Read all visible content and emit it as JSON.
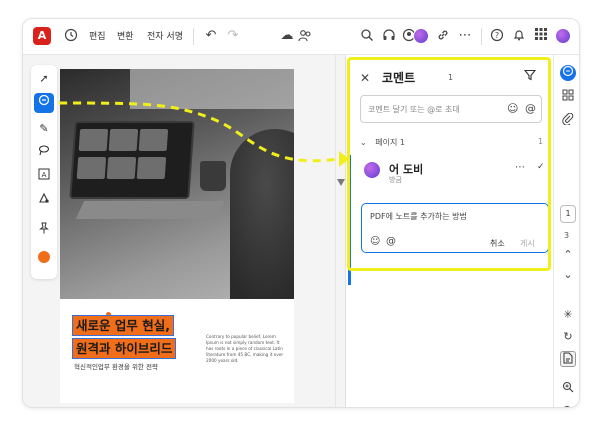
{
  "toolbar": {
    "logo_glyph": "A",
    "menu": [
      "편집",
      "변환",
      "전자 서명"
    ],
    "icons_left": [
      "home-icon",
      "undo-icon",
      "redo-icon",
      "cloud-icon",
      "share-people-icon"
    ],
    "icons_right": [
      "search-icon",
      "headset-icon",
      "collab-icon",
      "link-icon",
      "more-icon",
      "help-icon",
      "bell-icon",
      "apps-icon"
    ]
  },
  "left_tools": [
    "select-icon",
    "comment-icon",
    "pen-icon",
    "lasso-icon",
    "text-box-icon",
    "stamp-icon",
    "pin-icon",
    "color-swatch"
  ],
  "document": {
    "headline_line1": "새로운 업무 현실,",
    "headline_line2": "원격과 하이브리드",
    "subtitle": "혁신적인업무 환경을 위한 전략",
    "body_text": "Contrary to popular belief, Lorem Ipsum is not simply random text. It has roots in a piece of classical Latin literature from 45 BC, making it over 2000 years old."
  },
  "comments_panel": {
    "title": "코멘트",
    "count": "1",
    "input_placeholder": "코멘트 달기 또는 @로 초대",
    "section_label": "페이지 1",
    "section_count": "1",
    "comment": {
      "author": "어 도비",
      "time": "방금",
      "draft_text": "PDF에 노트를 추가하는 방법",
      "cancel_label": "취소",
      "post_label": "게시"
    }
  },
  "right_tools": {
    "page_current": "1",
    "page_total": "3"
  },
  "colors": {
    "accent": "#1473e6",
    "highlight": "#f06d1a",
    "callout": "#f1ef1a",
    "brand": "#d8221b"
  }
}
